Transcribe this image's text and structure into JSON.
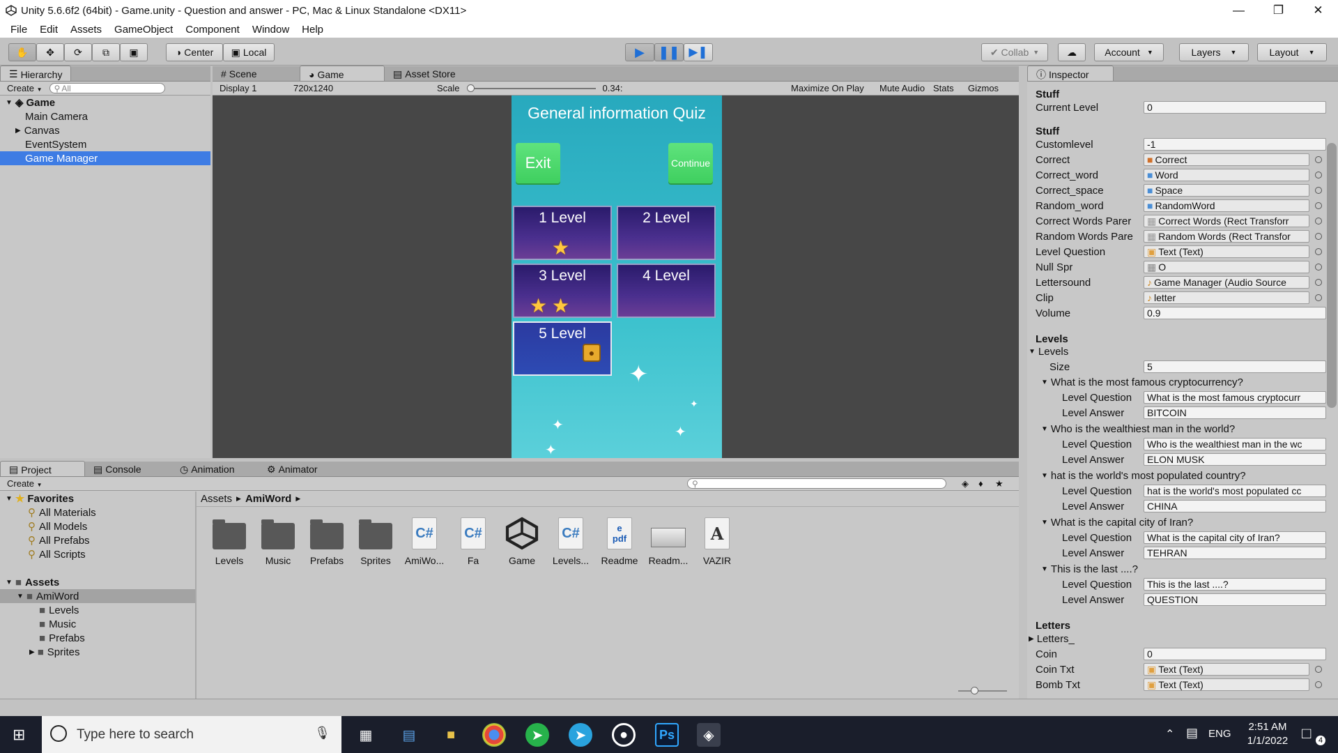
{
  "window": {
    "title": "Unity 5.6.6f2 (64bit) - Game.unity - Question and answer - PC, Mac & Linux Standalone <DX11>"
  },
  "menu": [
    "File",
    "Edit",
    "Assets",
    "GameObject",
    "Component",
    "Window",
    "Help"
  ],
  "toolbar": {
    "center": "Center",
    "local": "Local",
    "collab": "Collab",
    "account": "Account",
    "layers": "Layers",
    "layout": "Layout"
  },
  "hierarchy": {
    "tab": "Hierarchy",
    "create": "Create",
    "search_placeholder": "All",
    "scene": "Game",
    "items": [
      "Main Camera",
      "Canvas",
      "EventSystem",
      "Game Manager"
    ]
  },
  "game_tabs": [
    "Scene",
    "Game",
    "Asset Store"
  ],
  "game_bar": {
    "display": "Display 1",
    "resolution": "720x1240",
    "scale_label": "Scale",
    "scale_value": "0.34:",
    "maximize": "Maximize On Play",
    "mute": "Mute Audio",
    "stats": "Stats",
    "gizmos": "Gizmos"
  },
  "game": {
    "title": "General information Quiz",
    "exit": "Exit",
    "continue": "Continue",
    "levels": [
      {
        "label": "1 Level",
        "stars": 1
      },
      {
        "label": "2 Level",
        "stars": 0
      },
      {
        "label": "3 Level",
        "stars": 2
      },
      {
        "label": "4 Level",
        "stars": 0
      },
      {
        "label": "5 Level",
        "stars": 0,
        "locked": true
      }
    ]
  },
  "inspector": {
    "tab": "Inspector",
    "section1": "Stuff",
    "current_level_label": "Current Level",
    "current_level": "0",
    "section2": "Stuff",
    "fields": [
      {
        "label": "Customlevel",
        "value": "-1"
      },
      {
        "label": "Correct",
        "value": "Correct"
      },
      {
        "label": "Correct_word",
        "value": "Word"
      },
      {
        "label": "Correct_space",
        "value": "Space"
      },
      {
        "label": "Random_word",
        "value": "RandomWord"
      },
      {
        "label": "Correct Words Parer",
        "value": "Correct Words (Rect Transforr"
      },
      {
        "label": "Random Words Pare",
        "value": "Random Words (Rect Transfor"
      },
      {
        "label": "Level Question",
        "value": "Text (Text)"
      },
      {
        "label": "Null Spr",
        "value": "O"
      },
      {
        "label": "Lettersound",
        "value": "Game Manager (Audio Source"
      },
      {
        "label": "Clip",
        "value": "letter"
      },
      {
        "label": "Volume",
        "value": "0.9"
      }
    ],
    "levels_header": "Levels",
    "levels_fold": "Levels",
    "size_label": "Size",
    "size": "5",
    "level_question_label": "Level Question",
    "level_answer_label": "Level Answer",
    "questions": [
      {
        "title": "What is the most famous cryptocurrency?",
        "question": "What is the most famous cryptocurr",
        "answer": "BITCOIN"
      },
      {
        "title": "Who is the wealthiest man in the world?",
        "question": "Who is the wealthiest man in the wc",
        "answer": "ELON MUSK"
      },
      {
        "title": "hat is the world's most populated country?",
        "question": "hat is the world's most populated cc",
        "answer": "CHINA"
      },
      {
        "title": "What is the capital city of Iran?",
        "question": "What is the capital city of Iran?",
        "answer": "TEHRAN"
      },
      {
        "title": "This is the last ....?",
        "question": "This is the last ....?",
        "answer": "QUESTION"
      }
    ],
    "letters_header": "Letters",
    "letters_fold": "Letters_",
    "coin_label": "Coin",
    "coin": "0",
    "coin_txt_label": "Coin Txt",
    "coin_txt": "Text (Text)",
    "bomb_txt_label": "Bomb Txt",
    "bomb_txt": "Text (Text)"
  },
  "bottom_tabs": [
    "Project",
    "Console",
    "Animation",
    "Animator"
  ],
  "project": {
    "create": "Create",
    "favorites": "Favorites",
    "fav_items": [
      "All Materials",
      "All Models",
      "All Prefabs",
      "All Scripts"
    ],
    "assets": "Assets",
    "tree": [
      "AmiWord",
      "Levels",
      "Music",
      "Prefabs",
      "Sprites"
    ],
    "breadcrumb": [
      "Assets",
      "AmiWord"
    ],
    "files": [
      {
        "name": "Levels",
        "kind": "folder-icon"
      },
      {
        "name": "Music",
        "kind": "folder-icon"
      },
      {
        "name": "Prefabs",
        "kind": "folder-icon"
      },
      {
        "name": "Sprites",
        "kind": "folder-icon"
      },
      {
        "name": "AmiWo...",
        "kind": "csharp-script-icon"
      },
      {
        "name": "Fa",
        "kind": "csharp-script-icon"
      },
      {
        "name": "Game",
        "kind": "unity-scene-icon"
      },
      {
        "name": "Levels...",
        "kind": "csharp-script-icon"
      },
      {
        "name": "Readme",
        "kind": "pdf-icon"
      },
      {
        "name": "Readm...",
        "kind": "image-icon"
      },
      {
        "name": "VAZIR",
        "kind": "font-icon"
      }
    ]
  },
  "taskbar": {
    "search_placeholder": "Type here to search",
    "lang": "ENG",
    "time": "2:51 AM",
    "date": "1/1/2022",
    "notif": "4",
    "ps": "Ps"
  },
  "colors": {
    "selection": "#3e7ce4",
    "quiz_bg": "#3bc1cd",
    "green_btn": "#4fd96d",
    "star": "#ffc83d"
  }
}
